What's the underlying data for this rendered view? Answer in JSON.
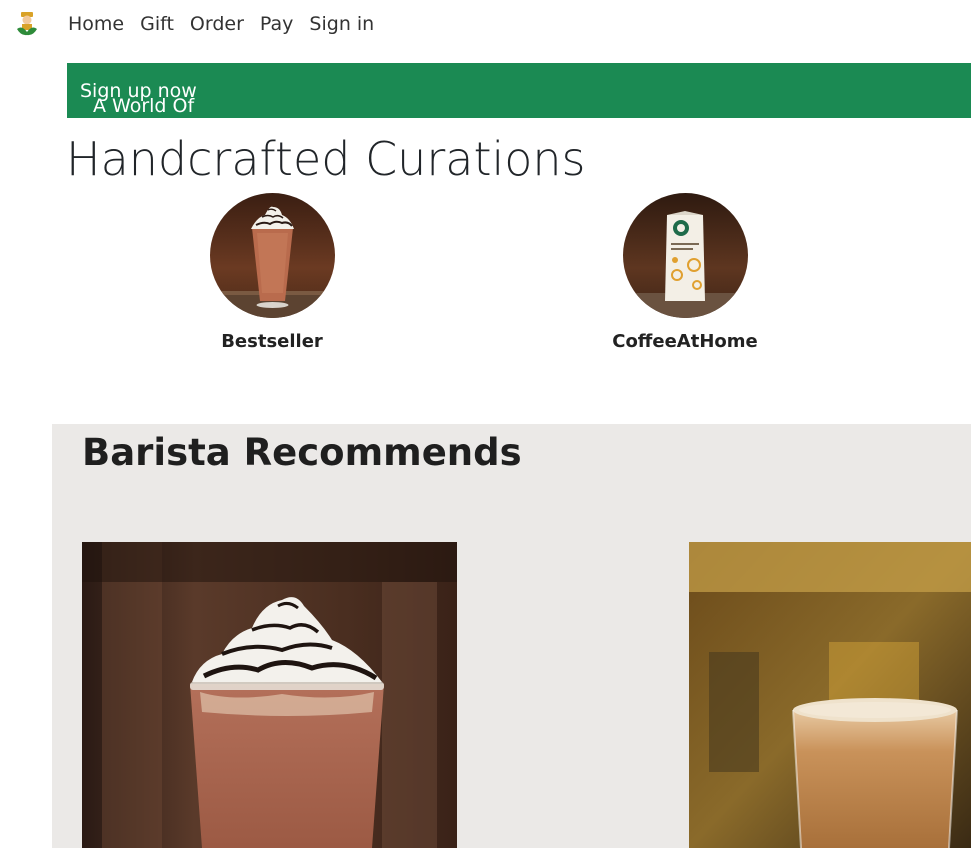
{
  "nav": {
    "links": [
      "Home",
      "Gift",
      "Order",
      "Pay",
      "Sign in"
    ]
  },
  "promo": {
    "text": "A World Of Awards awaits you!",
    "link": "Sign up now"
  },
  "page_title": "Handcrafted Curations",
  "curations": [
    {
      "label": "Bestseller"
    },
    {
      "label": "CoffeeAtHome"
    }
  ],
  "barista": {
    "title": "Barista Recommends"
  },
  "colors": {
    "promo_bg": "#1b8a53",
    "section_bg": "#ebe9e7"
  }
}
